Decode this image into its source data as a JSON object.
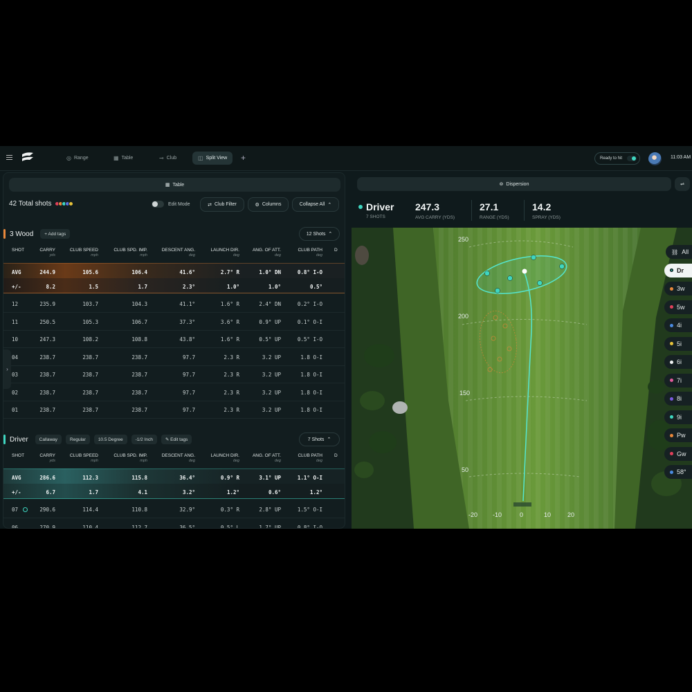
{
  "topbar": {
    "tabs": [
      {
        "label": "Range",
        "icon": "target-icon"
      },
      {
        "label": "Table",
        "icon": "table-icon"
      },
      {
        "label": "Club",
        "icon": "club-icon"
      },
      {
        "label": "Split View",
        "icon": "split-view-icon"
      }
    ],
    "active_tab": "Split View",
    "status": "Ready to hit",
    "time": "11:03 AM"
  },
  "left": {
    "header": "Table",
    "total_shots": "42 Total shots",
    "club_dot_colors": [
      "#e0405a",
      "#e8873a",
      "#3fd6c0",
      "#5a6fe0",
      "#e6c23a"
    ],
    "edit_mode_label": "Edit Mode",
    "club_filter_label": "Club Filter",
    "columns_label": "Columns",
    "collapse_label": "Collapse All",
    "columns": [
      {
        "label": "SHOT",
        "unit": ""
      },
      {
        "label": "CARRY",
        "unit": "yds"
      },
      {
        "label": "CLUB SPEED",
        "unit": "mph"
      },
      {
        "label": "CLUB SPD. IMP.",
        "unit": "mph"
      },
      {
        "label": "DESCENT ANG.",
        "unit": "deg"
      },
      {
        "label": "LAUNCH DIR.",
        "unit": "deg"
      },
      {
        "label": "ANG. OF ATT.",
        "unit": "deg"
      },
      {
        "label": "CLUB PATH",
        "unit": "deg"
      },
      {
        "label": "D",
        "unit": ""
      }
    ],
    "sections": [
      {
        "name": "3 Wood",
        "color": "#e8873a",
        "tags": [
          "+ Add tags"
        ],
        "shots_label": "12 Shots",
        "avg": [
          "AVG",
          "244.9",
          "105.6",
          "106.4",
          "41.6°",
          "2.7° R",
          "1.0° DN",
          "0.8° I-O"
        ],
        "pm": [
          "+/-",
          "8.2",
          "1.5",
          "1.7",
          "2.3°",
          "1.0°",
          "1.0°",
          "0.5°"
        ],
        "rows": [
          [
            "12",
            "235.9",
            "103.7",
            "104.3",
            "41.1°",
            "1.6° R",
            "2.4° DN",
            "0.2° I-O"
          ],
          [
            "11",
            "250.5",
            "105.3",
            "106.7",
            "37.3°",
            "3.6° R",
            "0.9° UP",
            "0.1° O-I"
          ],
          [
            "10",
            "247.3",
            "108.2",
            "108.8",
            "43.8°",
            "1.6° R",
            "0.5° UP",
            "0.5° I-O"
          ],
          [
            "04",
            "238.7",
            "238.7",
            "238.7",
            "97.7",
            "2.3 R",
            "3.2 UP",
            "1.8 O-I"
          ],
          [
            "03",
            "238.7",
            "238.7",
            "238.7",
            "97.7",
            "2.3 R",
            "3.2 UP",
            "1.8 O-I"
          ],
          [
            "02",
            "238.7",
            "238.7",
            "238.7",
            "97.7",
            "2.3 R",
            "3.2 UP",
            "1.8 O-I"
          ],
          [
            "01",
            "238.7",
            "238.7",
            "238.7",
            "97.7",
            "2.3 R",
            "3.2 UP",
            "1.8 O-I"
          ]
        ]
      },
      {
        "name": "Driver",
        "color": "#3fd6c0",
        "tags": [
          "Callaway",
          "Regular",
          "10.5 Degree",
          "-1/2 Inch",
          "✎ Edit tags"
        ],
        "shots_label": "7 Shots",
        "avg": [
          "AVG",
          "286.6",
          "112.3",
          "115.8",
          "36.4°",
          "0.9° R",
          "3.1° UP",
          "1.1° O-I"
        ],
        "pm": [
          "+/-",
          "6.7",
          "1.7",
          "4.1",
          "3.2°",
          "1.2°",
          "0.6°",
          "1.2°"
        ],
        "rows": [
          [
            "07",
            "290.6",
            "114.4",
            "110.8",
            "32.9°",
            "0.3° R",
            "2.8° UP",
            "1.5° O-I"
          ],
          [
            "06",
            "270.9",
            "110.4",
            "112.7",
            "36.5°",
            "0.5° L",
            "1.7° UP",
            "0.8° I-O"
          ]
        ]
      }
    ]
  },
  "right": {
    "header": "Dispersion",
    "club_name": "Driver",
    "club_shots": "7 SHOTS",
    "stats": [
      {
        "value": "247.3",
        "label": "AVG CARRY (YDS)"
      },
      {
        "value": "27.1",
        "label": "RANGE (YDS)"
      },
      {
        "value": "14.2",
        "label": "SPRAY (YDS)"
      }
    ],
    "y_axis": [
      "250",
      "200",
      "150",
      "50"
    ],
    "x_axis": [
      "-20",
      "-10",
      "0",
      "10",
      "20"
    ],
    "clubs": [
      {
        "label": "All",
        "color": ""
      },
      {
        "label": "Dr",
        "color": "#3fd6c0"
      },
      {
        "label": "3w",
        "color": "#e8873a"
      },
      {
        "label": "5w",
        "color": "#e0405a"
      },
      {
        "label": "4i",
        "color": "#4a8ae0"
      },
      {
        "label": "5i",
        "color": "#e6c23a"
      },
      {
        "label": "6i",
        "color": "#f1f4f4"
      },
      {
        "label": "7i",
        "color": "#e05a9a"
      },
      {
        "label": "8i",
        "color": "#7a5ae0"
      },
      {
        "label": "9i",
        "color": "#3fd6c0"
      },
      {
        "label": "Pw",
        "color": "#e8873a"
      },
      {
        "label": "Gw",
        "color": "#e0405a"
      },
      {
        "label": "58°",
        "color": "#4a8ae0"
      }
    ],
    "selected_club": "Dr"
  }
}
